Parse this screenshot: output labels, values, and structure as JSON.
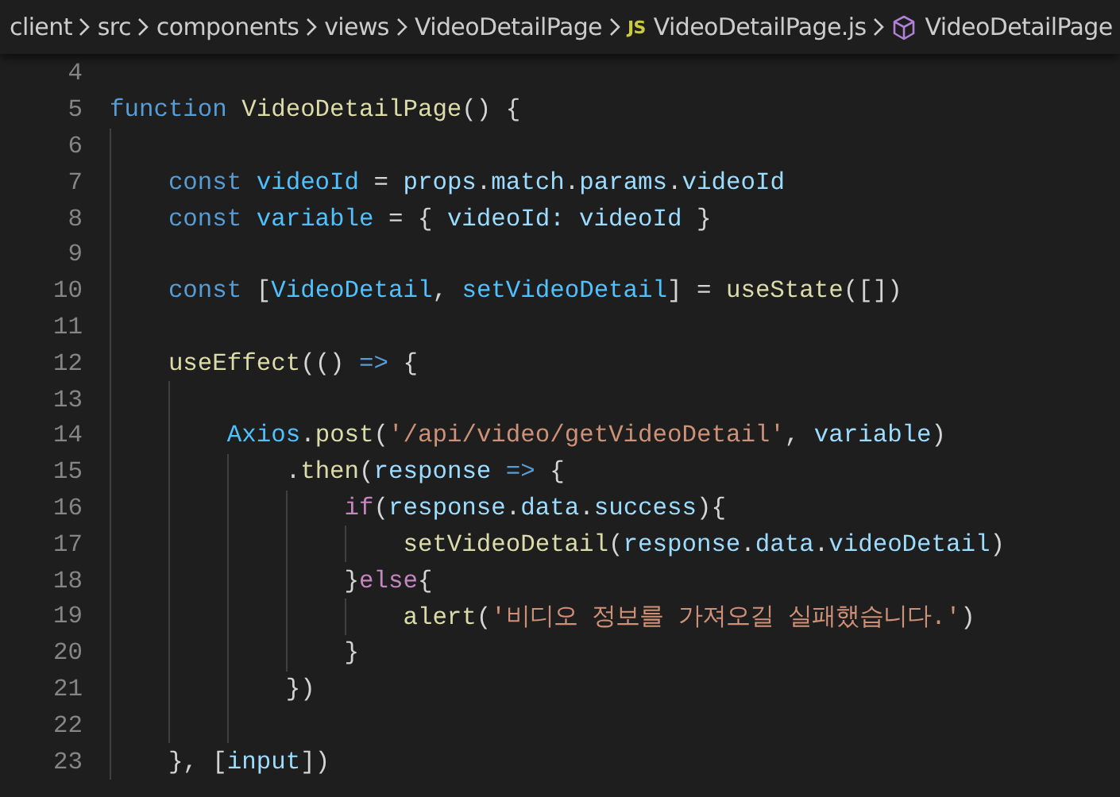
{
  "breadcrumb": [
    {
      "kind": "folder",
      "label": "client"
    },
    {
      "kind": "folder",
      "label": "src"
    },
    {
      "kind": "folder",
      "label": "components"
    },
    {
      "kind": "folder",
      "label": "views"
    },
    {
      "kind": "folder",
      "label": "VideoDetailPage"
    },
    {
      "kind": "file",
      "badge": "JS",
      "label": "VideoDetailPage.js"
    },
    {
      "kind": "symbol",
      "label": "VideoDetailPage"
    }
  ],
  "lines": [
    {
      "number": "4"
    },
    {
      "number": "5",
      "tokens": [
        {
          "kind": "keyword",
          "text": "function"
        },
        {
          "kind": "function",
          "text": " VideoDetailPage"
        },
        {
          "kind": "plain",
          "text": "() {"
        }
      ]
    },
    {
      "number": "6"
    },
    {
      "number": "7",
      "tokens": [
        {
          "kind": "keyword",
          "text": "    const"
        },
        {
          "kind": "constant",
          "text": " videoId"
        },
        {
          "kind": "plain",
          "text": " = "
        },
        {
          "kind": "variable",
          "text": "props"
        },
        {
          "kind": "plain",
          "text": "."
        },
        {
          "kind": "variable",
          "text": "match"
        },
        {
          "kind": "plain",
          "text": "."
        },
        {
          "kind": "variable",
          "text": "params"
        },
        {
          "kind": "plain",
          "text": "."
        },
        {
          "kind": "variable",
          "text": "videoId"
        }
      ]
    },
    {
      "number": "8",
      "tokens": [
        {
          "kind": "keyword",
          "text": "    const"
        },
        {
          "kind": "constant",
          "text": " variable"
        },
        {
          "kind": "plain",
          "text": " = { "
        },
        {
          "kind": "variable",
          "text": "videoId: videoId"
        },
        {
          "kind": "plain",
          "text": " }"
        }
      ]
    },
    {
      "number": "9"
    },
    {
      "number": "10",
      "tokens": [
        {
          "kind": "keyword",
          "text": "    const"
        },
        {
          "kind": "plain",
          "text": " ["
        },
        {
          "kind": "constant",
          "text": "VideoDetail"
        },
        {
          "kind": "plain",
          "text": ", "
        },
        {
          "kind": "constant",
          "text": "setVideoDetail"
        },
        {
          "kind": "plain",
          "text": "] = "
        },
        {
          "kind": "function",
          "text": "useState"
        },
        {
          "kind": "plain",
          "text": "([])"
        }
      ]
    },
    {
      "number": "11"
    },
    {
      "number": "12",
      "tokens": [
        {
          "kind": "function",
          "text": "    useEffect"
        },
        {
          "kind": "plain",
          "text": "(() "
        },
        {
          "kind": "keyword",
          "text": "=>"
        },
        {
          "kind": "plain",
          "text": " {"
        }
      ]
    },
    {
      "number": "13"
    },
    {
      "number": "14",
      "tokens": [
        {
          "kind": "constant",
          "text": "        Axios"
        },
        {
          "kind": "plain",
          "text": "."
        },
        {
          "kind": "function",
          "text": "post"
        },
        {
          "kind": "plain",
          "text": "("
        },
        {
          "kind": "string",
          "text": "'/api/video/getVideoDetail'"
        },
        {
          "kind": "plain",
          "text": ", "
        },
        {
          "kind": "variable",
          "text": "variable"
        },
        {
          "kind": "plain",
          "text": ")"
        }
      ]
    },
    {
      "number": "15",
      "tokens": [
        {
          "kind": "plain",
          "text": "            ."
        },
        {
          "kind": "function",
          "text": "then"
        },
        {
          "kind": "plain",
          "text": "("
        },
        {
          "kind": "variable",
          "text": "response"
        },
        {
          "kind": "keyword",
          "text": " =>"
        },
        {
          "kind": "plain",
          "text": " {"
        }
      ]
    },
    {
      "number": "16",
      "tokens": [
        {
          "kind": "control",
          "text": "                if"
        },
        {
          "kind": "plain",
          "text": "("
        },
        {
          "kind": "variable",
          "text": "response"
        },
        {
          "kind": "plain",
          "text": "."
        },
        {
          "kind": "variable",
          "text": "data"
        },
        {
          "kind": "plain",
          "text": "."
        },
        {
          "kind": "variable",
          "text": "success"
        },
        {
          "kind": "plain",
          "text": "){"
        }
      ]
    },
    {
      "number": "17",
      "tokens": [
        {
          "kind": "function",
          "text": "                    setVideoDetail"
        },
        {
          "kind": "plain",
          "text": "("
        },
        {
          "kind": "variable",
          "text": "response"
        },
        {
          "kind": "plain",
          "text": "."
        },
        {
          "kind": "variable",
          "text": "data"
        },
        {
          "kind": "plain",
          "text": "."
        },
        {
          "kind": "variable",
          "text": "videoDetail"
        },
        {
          "kind": "plain",
          "text": ")"
        }
      ]
    },
    {
      "number": "18",
      "tokens": [
        {
          "kind": "plain",
          "text": "                }"
        },
        {
          "kind": "control",
          "text": "else"
        },
        {
          "kind": "plain",
          "text": "{"
        }
      ]
    },
    {
      "number": "19",
      "tokens": [
        {
          "kind": "function",
          "text": "                    alert"
        },
        {
          "kind": "plain",
          "text": "("
        },
        {
          "kind": "string",
          "text": "'비디오 정보를 가져오길 실패했습니다.'"
        },
        {
          "kind": "plain",
          "text": ")"
        }
      ]
    },
    {
      "number": "20",
      "tokens": [
        {
          "kind": "plain",
          "text": "                }"
        }
      ]
    },
    {
      "number": "21",
      "tokens": [
        {
          "kind": "plain",
          "text": "            })"
        }
      ]
    },
    {
      "number": "22"
    },
    {
      "number": "23",
      "tokens": [
        {
          "kind": "plain",
          "text": "    }, ["
        },
        {
          "kind": "variable",
          "text": "input"
        },
        {
          "kind": "plain",
          "text": "])"
        }
      ]
    }
  ]
}
